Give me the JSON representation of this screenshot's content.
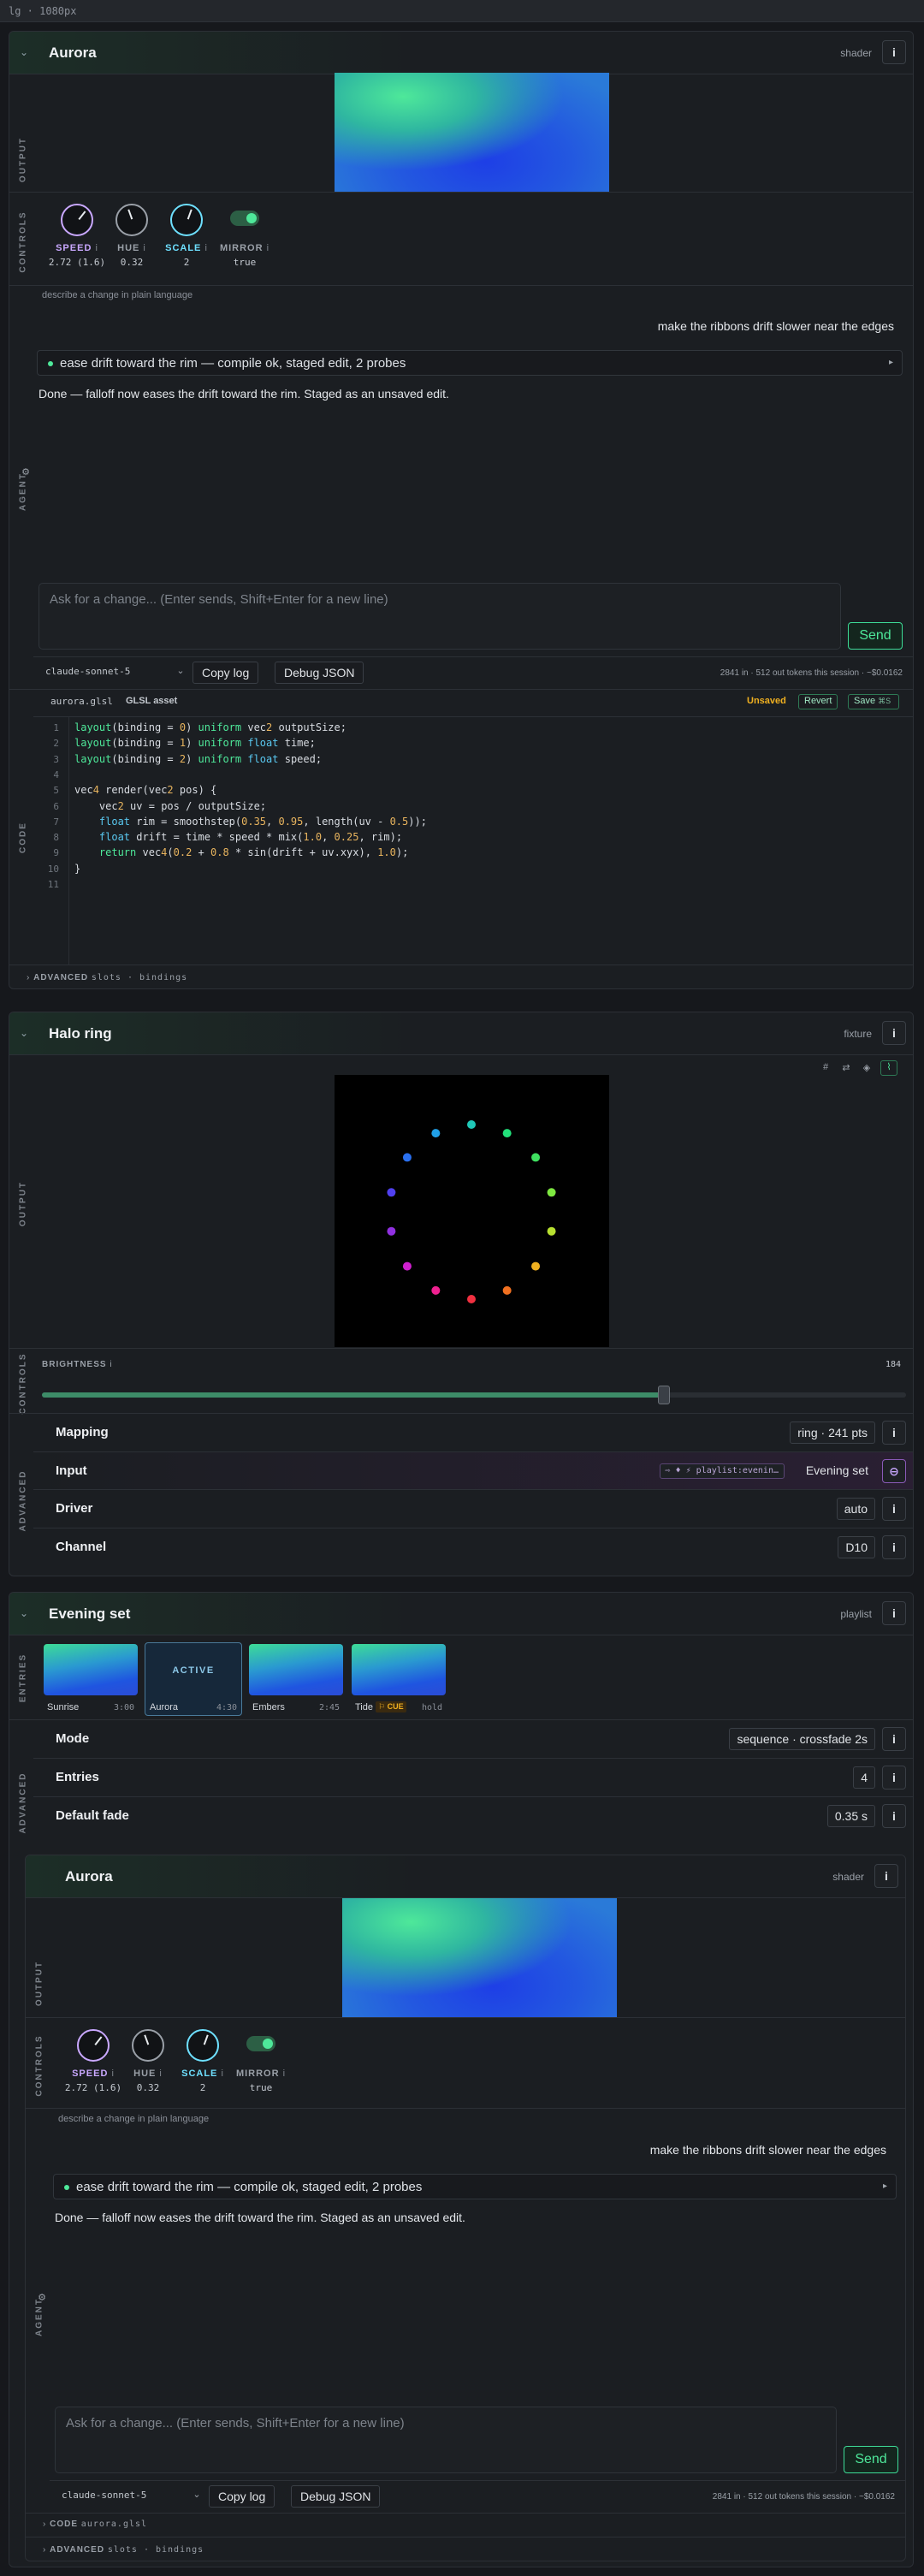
{
  "topbar": {
    "label": "lg · 1080px"
  },
  "aurora1": {
    "title": "Aurora",
    "type": "shader",
    "info": "i",
    "output_label": "OUTPUT",
    "controls_label": "CONTROLS",
    "agent_label": "AGENT",
    "code_label": "CODE",
    "advanced_label": "ADVANCED",
    "controls": [
      {
        "label": "SPEED",
        "info": "i",
        "value": "2.72 (1.6)",
        "color": "#c9a8ff"
      },
      {
        "label": "HUE",
        "info": "i",
        "value": "0.32",
        "color": "#9aa0a8"
      },
      {
        "label": "SCALE",
        "info": "i",
        "value": "2",
        "color": "#6ee0ff"
      },
      {
        "label": "MIRROR",
        "info": "i",
        "value": "true",
        "color": "#9aa0a8"
      }
    ],
    "hint": "describe a change in plain language",
    "user_msg": "make the ribbons drift slower near the edges",
    "tool_summary": "ease drift toward the rim — compile ok, staged edit, 2 probes",
    "tool_arrow": "▸",
    "agent_msg": "Done — falloff now eases the drift toward the rim. Staged as an unsaved edit.",
    "ask_placeholder": "Ask for a change... (Enter sends, Shift+Enter for a new line)",
    "send": "Send",
    "model": "claude-sonnet-5",
    "copy_log": "Copy log",
    "debug_json": "Debug JSON",
    "tokens": "2841 in · 512 out tokens this session · ~$0.0162",
    "code_file": "aurora.glsl",
    "code_kind": "GLSL asset",
    "unsaved": "Unsaved",
    "revert": "Revert",
    "save": "Save",
    "save_kbd": "⌘S",
    "code_lines": [
      "layout(binding = 0) uniform vec2 outputSize;",
      "layout(binding = 1) uniform float time;",
      "layout(binding = 2) uniform float speed;",
      "",
      "vec4 render(vec2 pos) {",
      "    vec2 uv = pos / outputSize;",
      "    float rim = smoothstep(0.35, 0.95, length(uv - 0.5));",
      "    float drift = time * speed * mix(1.0, 0.25, rim);",
      "    return vec4(0.2 + 0.8 * sin(drift + uv.xyx), 1.0);",
      "}",
      ""
    ],
    "advanced_sub": "slots · bindings"
  },
  "halo": {
    "title": "Halo ring",
    "type": "fixture",
    "info": "i",
    "output_label": "OUTPUT",
    "controls_label": "CONTROLS",
    "advanced_label": "ADVANCED",
    "brightness_label": "BRIGHTNESS",
    "brightness_info": "i",
    "brightness_value": "184",
    "brightness_fraction": 0.72,
    "props": [
      {
        "label": "Mapping",
        "value": "ring · 241 pts"
      },
      {
        "label": "Input",
        "value": "Evening set",
        "chip": "⇨ ♦ ⚡ playlist:evenin…"
      },
      {
        "label": "Driver",
        "value": "auto"
      },
      {
        "label": "Channel",
        "value": "D10"
      }
    ],
    "dot_colors": [
      "#1fc8b8",
      "#22e07a",
      "#3fe060",
      "#7ee840",
      "#b8e030",
      "#f0b020",
      "#f07020",
      "#f03040",
      "#f02090",
      "#d020d0",
      "#9030e0",
      "#5040f0",
      "#2a70f0",
      "#20a0e8"
    ]
  },
  "evening": {
    "title": "Evening set",
    "type": "playlist",
    "info": "i",
    "entries_label": "ENTRIES",
    "advanced_label": "ADVANCED",
    "entries": [
      {
        "name": "Sunrise",
        "dur": "3:00"
      },
      {
        "name": "Aurora",
        "dur": "4:30",
        "active": "ACTIVE"
      },
      {
        "name": "Embers",
        "dur": "2:45"
      },
      {
        "name": "Tide",
        "cue": "⚐ CUE",
        "dur": "hold"
      }
    ],
    "props": [
      {
        "label": "Mode",
        "value": "sequence · crossfade 2s"
      },
      {
        "label": "Entries",
        "value": "4"
      },
      {
        "label": "Default fade",
        "value": "0.35 s"
      }
    ]
  },
  "aurora2": {
    "title": "Aurora",
    "type": "shader",
    "info": "i",
    "output_label": "OUTPUT",
    "controls_label": "CONTROLS",
    "agent_label": "AGENT",
    "controls": [
      {
        "label": "SPEED",
        "info": "i",
        "value": "2.72 (1.6)",
        "color": "#c9a8ff"
      },
      {
        "label": "HUE",
        "info": "i",
        "value": "0.32",
        "color": "#9aa0a8"
      },
      {
        "label": "SCALE",
        "info": "i",
        "value": "2",
        "color": "#6ee0ff"
      },
      {
        "label": "MIRROR",
        "info": "i",
        "value": "true",
        "color": "#9aa0a8"
      }
    ],
    "hint": "describe a change in plain language",
    "user_msg": "make the ribbons drift slower near the edges",
    "tool_summary": "ease drift toward the rim — compile ok, staged edit, 2 probes",
    "tool_arrow": "▸",
    "agent_msg": "Done — falloff now eases the drift toward the rim. Staged as an unsaved edit.",
    "ask_placeholder": "Ask for a change... (Enter sends, Shift+Enter for a new line)",
    "send": "Send",
    "model": "claude-sonnet-5",
    "copy_log": "Copy log",
    "debug_json": "Debug JSON",
    "tokens": "2841 in · 512 out tokens this session · ~$0.0162",
    "code_row_label": "CODE",
    "code_row_sub": "aurora.glsl",
    "advanced_row_label": "ADVANCED",
    "advanced_row_sub": "slots · bindings"
  },
  "colors": {
    "accent": "#4ee89a",
    "purple": "#c9a8ff",
    "cyan": "#6ee0ff",
    "unsaved": "#f0b020"
  }
}
